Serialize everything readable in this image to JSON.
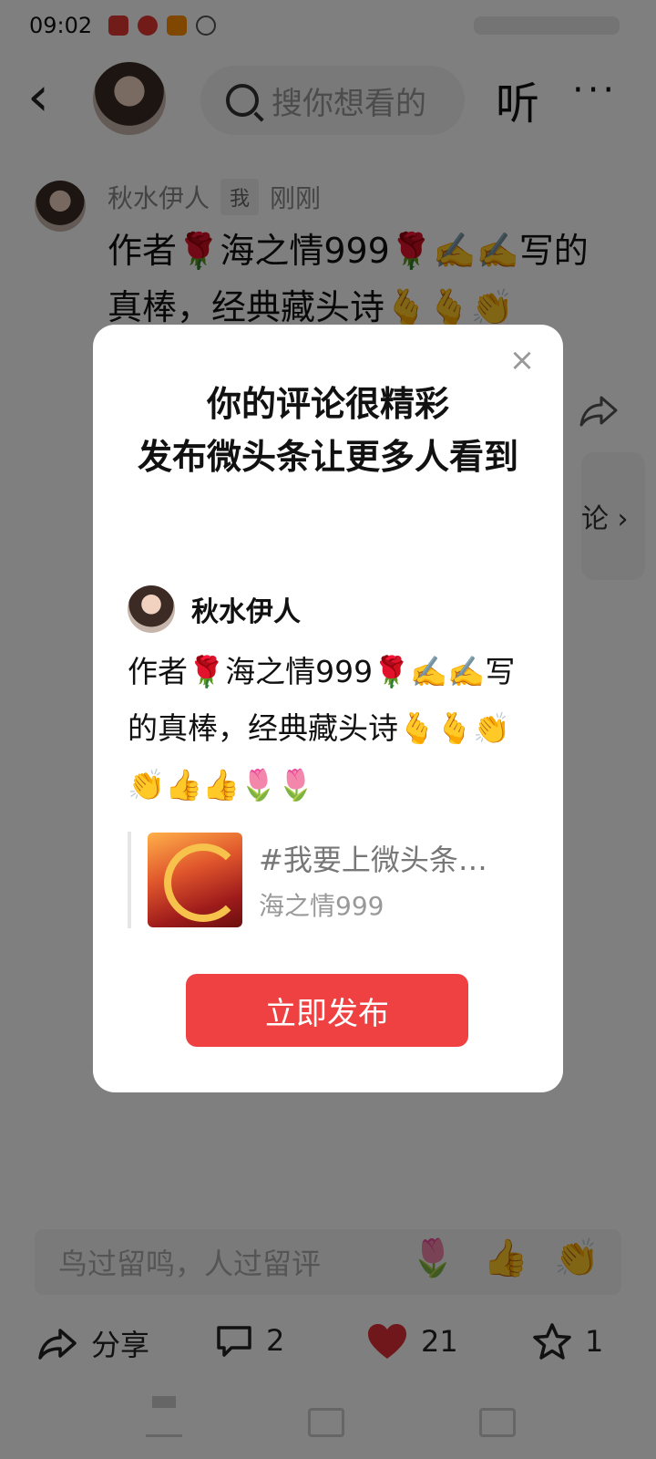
{
  "status": {
    "time": "09:02"
  },
  "header": {
    "back_glyph": "‹",
    "search_placeholder": "搜你想看的",
    "listen_label": "听",
    "more_glyph": "···"
  },
  "comment": {
    "author": "秋水伊人",
    "badge": "我",
    "time": "刚刚",
    "text": "作者🌹海之情999🌹✍️✍️写的真棒，经典藏头诗🫰🫰👏",
    "side_fragment": "论 ›"
  },
  "modal": {
    "title": "你的评论很精彩\n发布微头条让更多人看到",
    "user_name": "秋水伊人",
    "text": "作者🌹海之情999🌹✍️✍️写的真棒，经典藏头诗🫰🫰👏👏👍👍🌷🌷",
    "quote_title": "#我要上微头条…",
    "quote_author": "海之情999",
    "publish_label": "立即发布",
    "close_glyph": "×"
  },
  "input": {
    "placeholder": "鸟过留鸣，人过留评",
    "quick_emojis": [
      "🌷",
      "👍",
      "👏"
    ]
  },
  "actions": {
    "share_label": "分享",
    "comment_count": "2",
    "like_count": "21",
    "favorite_count": "1"
  },
  "colors": {
    "accent": "#f04142",
    "like": "#e02f36"
  },
  "icons": [
    "back-icon",
    "search-icon",
    "more-icon",
    "share-icon",
    "comment-icon",
    "heart-icon",
    "star-icon",
    "close-icon"
  ]
}
